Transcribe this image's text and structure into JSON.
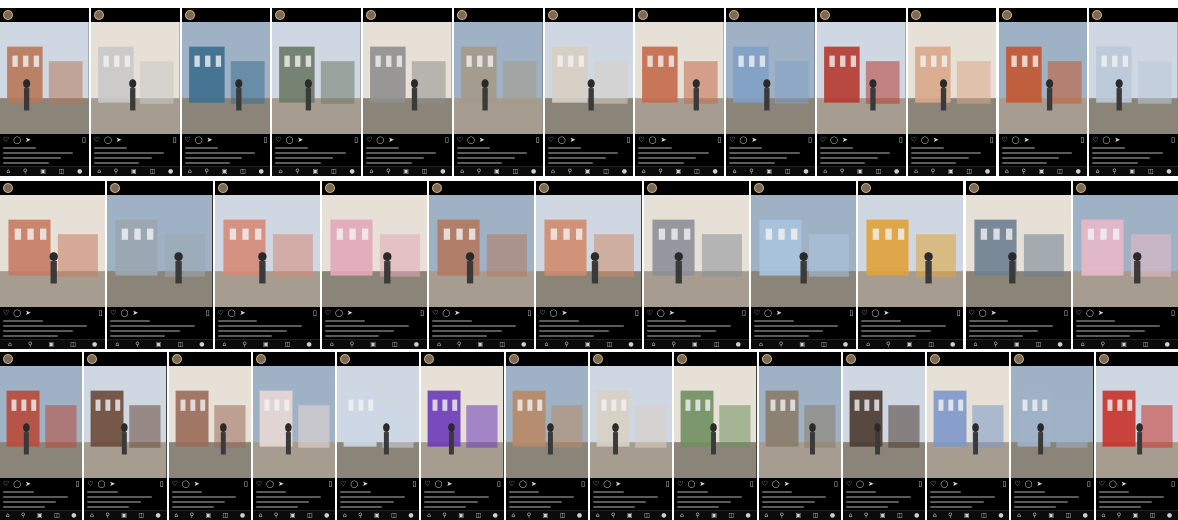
{
  "collage": {
    "rows": [
      {
        "tiles": [
          {
            "scene": "trees-building",
            "accent": "#b7785a"
          },
          {
            "scene": "street-pose",
            "accent": "#c9c9c9"
          },
          {
            "scene": "lamp-portrait",
            "accent": "#3c6f8f"
          },
          {
            "scene": "street-interior",
            "accent": "#6d7a66"
          },
          {
            "scene": "motorbike",
            "accent": "#8f8f8f"
          },
          {
            "scene": "sit-pose",
            "accent": "#a39a8a"
          },
          {
            "scene": "colonnade",
            "accent": "#d6cfc4"
          },
          {
            "scene": "white-building",
            "accent": "#c46a4a"
          },
          {
            "scene": "sitting-luggage",
            "accent": "#7fa1c7"
          },
          {
            "scene": "red-building",
            "accent": "#b53a2f"
          },
          {
            "scene": "facade-big",
            "accent": "#d9a88a"
          },
          {
            "scene": "night-facade",
            "accent": "#c3572f"
          },
          {
            "scene": "white-facade",
            "accent": "#b9c9d8"
          }
        ]
      },
      {
        "tiles": [
          {
            "scene": "facade-lamp",
            "accent": "#c77b63"
          },
          {
            "scene": "car-facade",
            "accent": "#9aa7b2"
          },
          {
            "scene": "hijab-pose",
            "accent": "#d58a77"
          },
          {
            "scene": "pink-pose",
            "accent": "#e2a7b8"
          },
          {
            "scene": "facade-street",
            "accent": "#b37a5f"
          },
          {
            "scene": "tower-church",
            "accent": "#cf8c6e"
          },
          {
            "scene": "church-night",
            "accent": "#8d8f99"
          },
          {
            "scene": "pink-street",
            "accent": "#a9c4de"
          },
          {
            "scene": "night-crowd",
            "accent": "#e0a238"
          },
          {
            "scene": "man-building",
            "accent": "#6e7f91"
          },
          {
            "scene": "pink-dress",
            "accent": "#e8b9c9"
          }
        ]
      },
      {
        "tiles": [
          {
            "scene": "group-photo",
            "accent": "#b84a3b"
          },
          {
            "scene": "street-lamp",
            "accent": "#6a4a3a"
          },
          {
            "scene": "hijab-portrait",
            "accent": "#9a6b5a"
          },
          {
            "scene": "white-columns",
            "accent": "#e7d9d5"
          },
          {
            "scene": "church-blue",
            "accent": "#cdd7e6"
          },
          {
            "scene": "night-purple",
            "accent": "#6a3bb8"
          },
          {
            "scene": "plaza-bike",
            "accent": "#b88a66"
          },
          {
            "scene": "sitting-white",
            "accent": "#d8d0c5"
          },
          {
            "scene": "white-shirt",
            "accent": "#6f8f5f"
          },
          {
            "scene": "street-old",
            "accent": "#8a7c6a"
          },
          {
            "scene": "trees-evening",
            "accent": "#4a3a2f"
          },
          {
            "scene": "blue-dress",
            "accent": "#7c98c9"
          },
          {
            "scene": "two-people",
            "accent": "#9fb3c9"
          },
          {
            "scene": "red-booth",
            "accent": "#c8322a"
          }
        ]
      }
    ]
  }
}
